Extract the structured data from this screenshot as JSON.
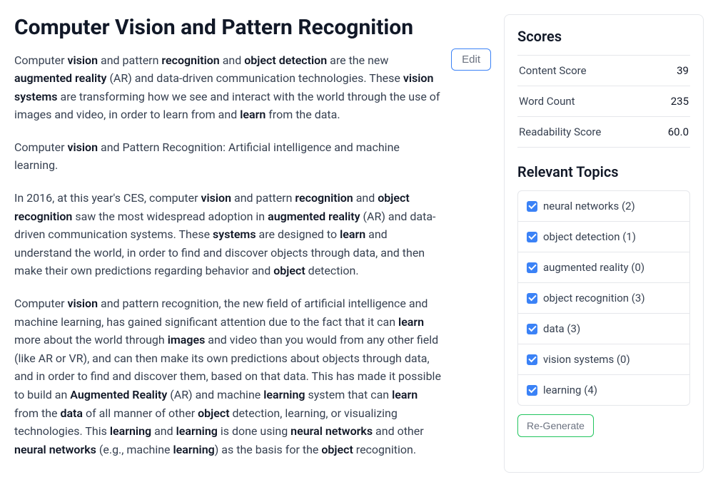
{
  "main": {
    "title": "Computer Vision and Pattern Recognition",
    "edit_label": "Edit",
    "paragraphs": [
      "Computer <strong>vision</strong> and pattern <strong>recognition</strong> and <strong>object detection</strong> are the new <strong>augmented reality</strong> (AR) and data-driven communication technologies. These <strong>vision systems</strong> are transforming how we see and interact with the world through the use of images and video, in order to learn from and <strong>learn</strong> from the data.",
      "Computer <strong>vision</strong> and Pattern Recognition: Artificial intelligence and machine learning.",
      "In 2016, at this year's CES, computer <strong>vision</strong> and pattern <strong>recognition</strong> and <strong>object recognition</strong> saw the most widespread adoption in <strong>augmented reality</strong> (AR) and data-driven communication systems. These <strong>systems</strong> are designed to <strong>learn</strong> and understand the world, in order to find and discover objects through data, and then make their own predictions regarding behavior and <strong>object</strong> detection.",
      "Computer <strong>vision</strong> and pattern recognition, the new field of artificial intelligence and machine learning, has gained significant attention due to the fact that it can <strong>learn</strong> more about the world through <strong>images</strong> and video than you would from any other field (like AR or VR), and can then make its own predictions about objects through data, and in order to find and discover them, based on that data. This has made it possible to build an <strong>Augmented Reality</strong> (AR) and machine <strong>learning</strong> system that can <strong>learn</strong> from the <strong>data</strong> of all manner of other <strong>object</strong> detection, learning, or visualizing technologies. This <strong>learning</strong> and <strong>learning</strong> is done using <strong>neural networks</strong> and other <strong>neural networks</strong> (e.g., machine <strong>learning</strong>) as the basis for the <strong>object</strong> recognition."
    ]
  },
  "sidebar": {
    "scores_heading": "Scores",
    "scores": [
      {
        "label": "Content Score",
        "value": "39"
      },
      {
        "label": "Word Count",
        "value": "235"
      },
      {
        "label": "Readability Score",
        "value": "60.0"
      }
    ],
    "topics_heading": "Relevant Topics",
    "topics": [
      {
        "label": "neural networks (2)",
        "checked": true
      },
      {
        "label": "object detection (1)",
        "checked": true
      },
      {
        "label": "augmented reality (0)",
        "checked": true
      },
      {
        "label": "object recognition (3)",
        "checked": true
      },
      {
        "label": "data (3)",
        "checked": true
      },
      {
        "label": "vision systems (0)",
        "checked": true
      },
      {
        "label": "learning (4)",
        "checked": true
      }
    ],
    "regen_label": "Re-Generate"
  }
}
